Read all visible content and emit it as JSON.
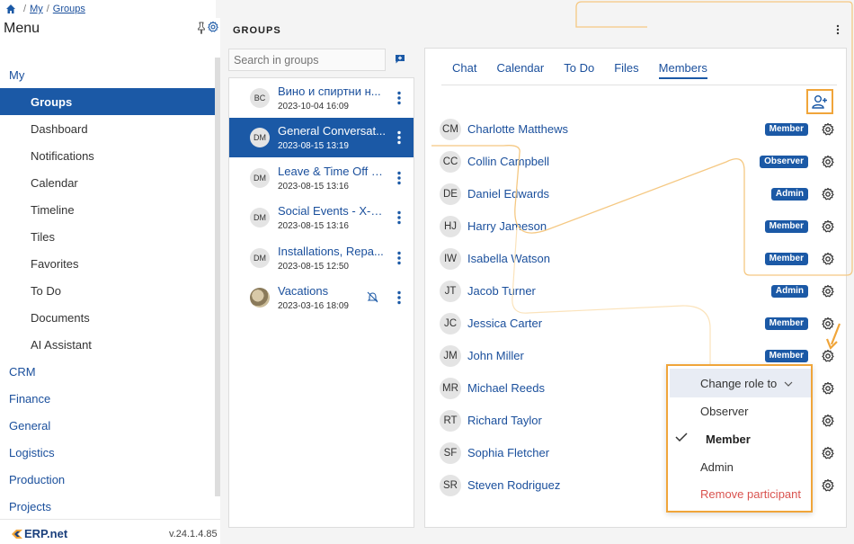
{
  "breadcrumb": {
    "items": [
      "My",
      "Groups"
    ]
  },
  "sidebar": {
    "title": "Menu",
    "items": [
      {
        "label": "My",
        "level": "top"
      },
      {
        "label": "Groups",
        "level": "sub",
        "active": true
      },
      {
        "label": "Dashboard",
        "level": "sub"
      },
      {
        "label": "Notifications",
        "level": "sub"
      },
      {
        "label": "Calendar",
        "level": "sub"
      },
      {
        "label": "Timeline",
        "level": "sub"
      },
      {
        "label": "Tiles",
        "level": "sub"
      },
      {
        "label": "Favorites",
        "level": "sub"
      },
      {
        "label": "To Do",
        "level": "sub"
      },
      {
        "label": "Documents",
        "level": "sub"
      },
      {
        "label": "AI Assistant",
        "level": "sub"
      },
      {
        "label": "CRM",
        "level": "top"
      },
      {
        "label": "Finance",
        "level": "top"
      },
      {
        "label": "General",
        "level": "top"
      },
      {
        "label": "Logistics",
        "level": "top"
      },
      {
        "label": "Production",
        "level": "top"
      },
      {
        "label": "Projects",
        "level": "top"
      }
    ],
    "footer": {
      "logo": "ERP.net",
      "version": "v.24.1.4.85"
    }
  },
  "groups": {
    "title": "GROUPS",
    "search_placeholder": "Search in groups",
    "list": [
      {
        "avatar": "BC",
        "name": "Вино и спиртни н...",
        "date": "2023-10-04 16:09",
        "active": false,
        "muted": false
      },
      {
        "avatar": "DM",
        "name": "General Conversat...",
        "date": "2023-08-15 13:19",
        "active": true,
        "muted": false
      },
      {
        "avatar": "DM",
        "name": "Leave & Time Off - ...",
        "date": "2023-08-15 13:16",
        "active": false,
        "muted": false
      },
      {
        "avatar": "DM",
        "name": "Social Events - X-T...",
        "date": "2023-08-15 13:16",
        "active": false,
        "muted": false
      },
      {
        "avatar": "DM",
        "name": "Installations, Repa...",
        "date": "2023-08-15 12:50",
        "active": false,
        "muted": false
      },
      {
        "avatar": "",
        "name": "Vacations",
        "date": "2023-03-16 18:09",
        "active": false,
        "muted": true
      }
    ]
  },
  "tabs": [
    "Chat",
    "Calendar",
    "To Do",
    "Files",
    "Members"
  ],
  "active_tab": "Members",
  "members": [
    {
      "initials": "CM",
      "name": "Charlotte Matthews",
      "role": "Member"
    },
    {
      "initials": "CC",
      "name": "Collin Campbell",
      "role": "Observer"
    },
    {
      "initials": "DE",
      "name": "Daniel Edwards",
      "role": "Admin"
    },
    {
      "initials": "HJ",
      "name": "Harry Jameson",
      "role": "Member"
    },
    {
      "initials": "IW",
      "name": "Isabella Watson",
      "role": "Member"
    },
    {
      "initials": "JT",
      "name": "Jacob Turner",
      "role": "Admin"
    },
    {
      "initials": "JC",
      "name": "Jessica Carter",
      "role": "Member"
    },
    {
      "initials": "JM",
      "name": "John Miller",
      "role": "Member"
    },
    {
      "initials": "MR",
      "name": "Michael Reeds",
      "role": ""
    },
    {
      "initials": "RT",
      "name": "Richard Taylor",
      "role": ""
    },
    {
      "initials": "SF",
      "name": "Sophia Fletcher",
      "role": ""
    },
    {
      "initials": "SR",
      "name": "Steven Rodriguez",
      "role": ""
    }
  ],
  "role_menu": {
    "header": "Change role to",
    "options": [
      "Observer",
      "Member",
      "Admin"
    ],
    "selected": "Member",
    "remove": "Remove participant"
  },
  "colors": {
    "brand": "#1b59a6",
    "accent": "#f0a53a",
    "danger": "#d9534f"
  }
}
